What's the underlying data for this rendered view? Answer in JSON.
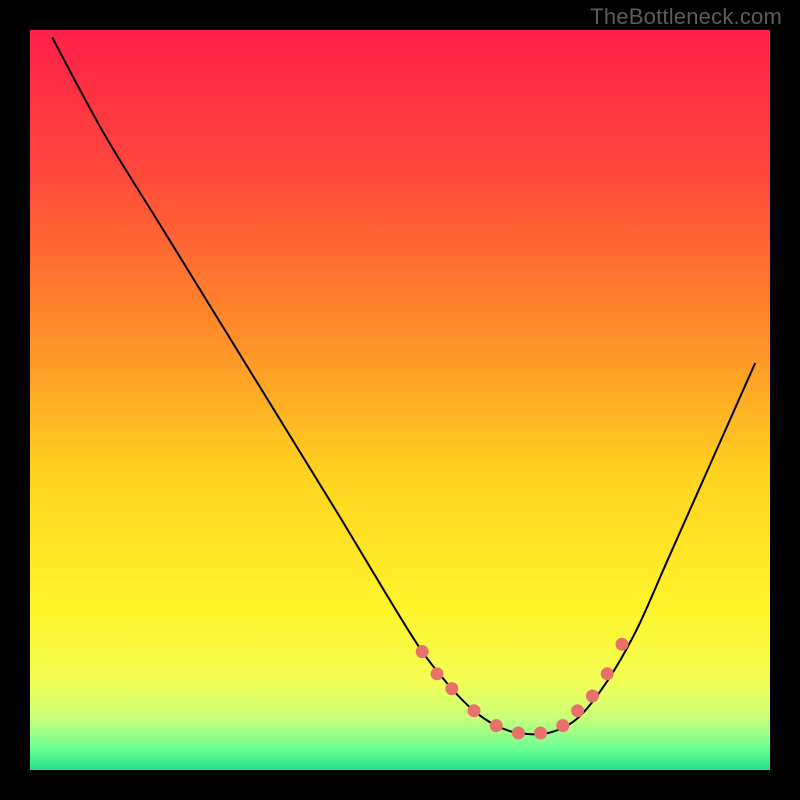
{
  "watermark": "TheBottleneck.com",
  "chart_data": {
    "type": "line",
    "title": "",
    "xlabel": "",
    "ylabel": "",
    "xlim": [
      0,
      100
    ],
    "ylim": [
      0,
      100
    ],
    "grid": false,
    "legend": false,
    "gradient_stops": [
      {
        "offset": 0.0,
        "color": "#ff1f4a"
      },
      {
        "offset": 0.2,
        "color": "#ff4a3a"
      },
      {
        "offset": 0.4,
        "color": "#ff8a2a"
      },
      {
        "offset": 0.6,
        "color": "#ffd21f"
      },
      {
        "offset": 0.78,
        "color": "#fff42a"
      },
      {
        "offset": 0.88,
        "color": "#f4ff55"
      },
      {
        "offset": 0.93,
        "color": "#c9ff7a"
      },
      {
        "offset": 0.97,
        "color": "#6dff94"
      },
      {
        "offset": 1.0,
        "color": "#23e28a"
      }
    ],
    "series": [
      {
        "name": "bottleneck-curve",
        "x": [
          3,
          10,
          18,
          26,
          34,
          42,
          48,
          53,
          57,
          60,
          63,
          66,
          70,
          74,
          78,
          82,
          86,
          90,
          94,
          98
        ],
        "y": [
          99,
          86,
          73,
          60,
          47,
          34,
          24,
          16,
          11,
          8,
          6,
          5,
          5,
          7,
          12,
          19,
          28,
          37,
          46,
          55
        ]
      }
    ],
    "markers": {
      "name": "curve-dots",
      "color": "#e9716b",
      "x": [
        53,
        55,
        57,
        60,
        63,
        66,
        69,
        72,
        74,
        76,
        78,
        80
      ],
      "y": [
        16,
        13,
        11,
        8,
        6,
        5,
        5,
        6,
        8,
        10,
        13,
        17
      ]
    }
  }
}
